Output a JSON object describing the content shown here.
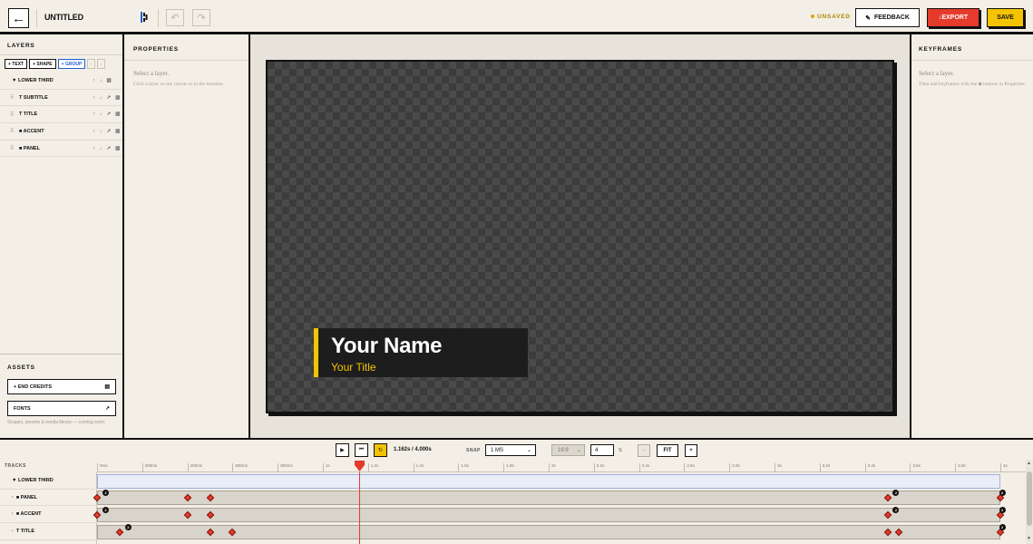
{
  "header": {
    "back_icon": "←",
    "project_title": "UNTITLED",
    "undo_icon": "↶",
    "redo_icon": "↷",
    "unsaved": "UNSAVED",
    "feedback_label": "FEEDBACK",
    "feedback_icon": "✎",
    "export_label": "↓EXPORT",
    "save_label": "SAVE"
  },
  "layers": {
    "title": "LAYERS",
    "add_text": "+ TEXT",
    "add_shape": "+ SHAPE",
    "add_group": "+ GROUP",
    "up_icon": "↑",
    "down_icon": "↓",
    "items": [
      {
        "label": "▼ LOWER THIRD"
      },
      {
        "label": "T SUBTITLE"
      },
      {
        "label": "T TITLE"
      },
      {
        "label": "■ ACCENT"
      },
      {
        "label": "■ PANEL"
      }
    ],
    "action_up": "↑",
    "action_down": "↓",
    "action_link": "↗",
    "action_delete": "🗑"
  },
  "assets": {
    "title": "ASSETS",
    "end_credits_label": "+ END CREDITS",
    "end_credits_icon": "🎬",
    "fonts_label": "FONTS",
    "fonts_icon": "↗",
    "note": "Shapes, presets & media library — coming soon."
  },
  "properties": {
    "title": "PROPERTIES",
    "hint": "Select a layer.",
    "sub_hint": "Click a layer on the canvas or in the timeline."
  },
  "canvas": {
    "title_text": "Your Name",
    "subtitle_text": "Your Title",
    "panel_color": "#1d1d1d",
    "accent_color": "#f5c400"
  },
  "keyframes": {
    "title": "KEYFRAMES",
    "hint": "Select a layer.",
    "sub_hint": "Then add keyframes with the ◆ buttons in Properties."
  },
  "transport": {
    "play_icon": "▶",
    "rewind_icon": "⏮",
    "loop_icon": "↻",
    "timecode": "1.162s / 4.000s",
    "snap_label": "SNAP",
    "snap_value": "1 MS",
    "ratio_value": "16:9",
    "duration_value": "4",
    "duration_unit": "S",
    "zoom_out": "−",
    "fit_label": "FIT",
    "zoom_in": "+",
    "caret": "⌄"
  },
  "timeline": {
    "tracks_label": "TRACKS",
    "ticks": [
      "0ms",
      "200ms",
      "400ms",
      "600ms",
      "800ms",
      "1s",
      "1.2s",
      "1.4s",
      "1.6s",
      "1.8s",
      "2s",
      "2.2s",
      "2.4s",
      "2.6s",
      "2.8s",
      "3s",
      "3.2s",
      "3.4s",
      "3.6s",
      "3.8s",
      "4s"
    ],
    "tracks": [
      {
        "label": "▼ LOWER THIRD"
      },
      {
        "label": "■ PANEL"
      },
      {
        "label": "■ ACCENT"
      },
      {
        "label": "T TITLE"
      }
    ],
    "badge_count": "2",
    "duration_s": 4.0,
    "playhead_s": 1.162,
    "track_keyframes": [
      [],
      [
        0.0,
        0.4,
        0.5,
        3.5,
        4.0
      ],
      [
        0.0,
        0.4,
        0.5,
        3.5,
        4.0
      ],
      [
        0.1,
        0.5,
        0.6,
        3.5,
        3.55,
        4.0
      ]
    ],
    "track_badges": [
      [],
      [
        0.02,
        3.52,
        3.99
      ],
      [
        0.02,
        3.52,
        3.99
      ],
      [
        0.12,
        3.99
      ]
    ]
  }
}
